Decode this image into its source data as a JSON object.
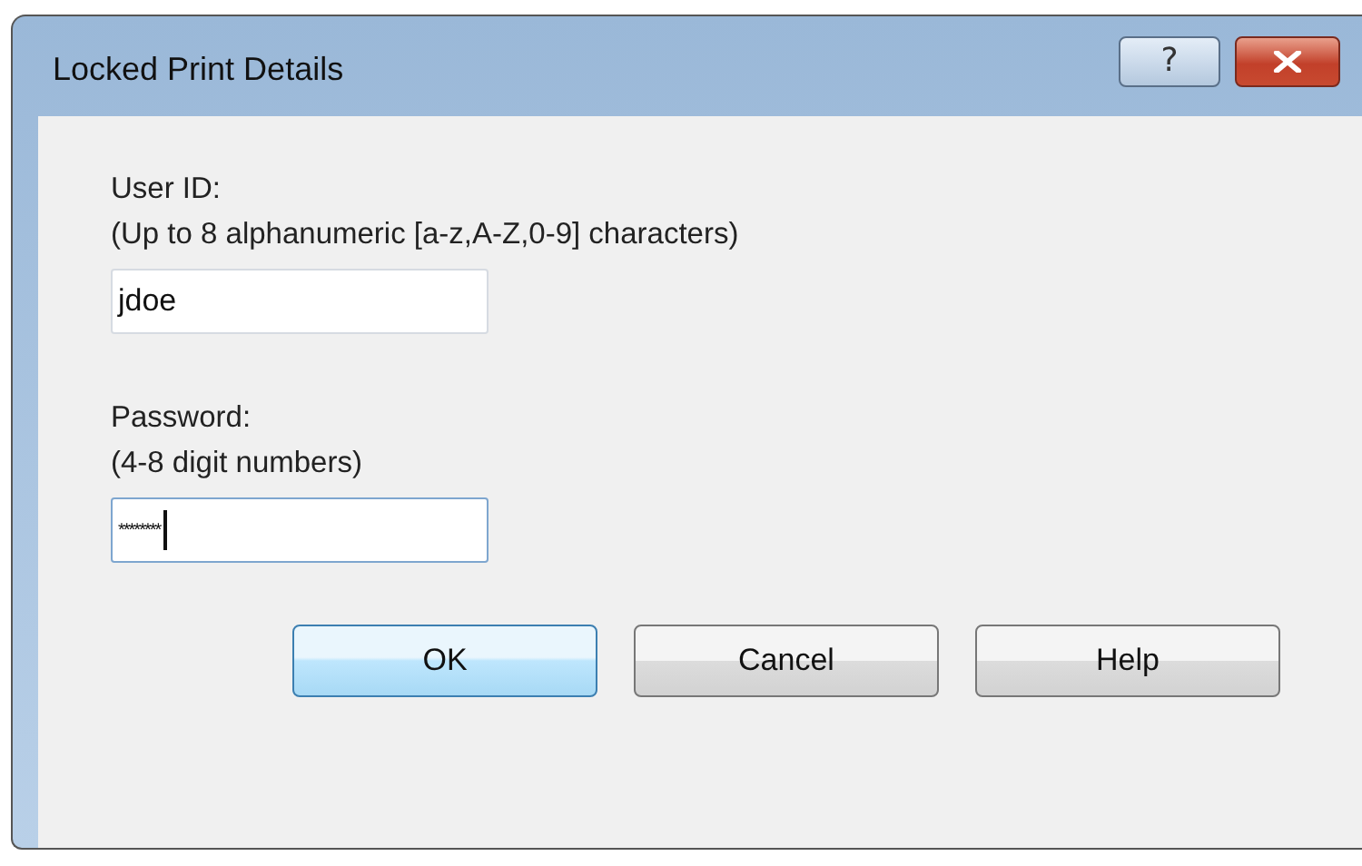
{
  "window": {
    "title": "Locked Print Details",
    "help_glyph": "?"
  },
  "fields": [
    {
      "label": "User ID:",
      "hint": "(Up to 8 alphanumeric [a-z,A-Z,0-9] characters)",
      "value": "jdoe",
      "focused": false
    },
    {
      "label": "Password:",
      "hint": "(4-8 digit numbers)",
      "value": "********",
      "focused": true
    }
  ],
  "buttons": [
    {
      "label": "OK",
      "default": true
    },
    {
      "label": "Cancel",
      "default": false
    },
    {
      "label": "Help",
      "default": false
    }
  ]
}
